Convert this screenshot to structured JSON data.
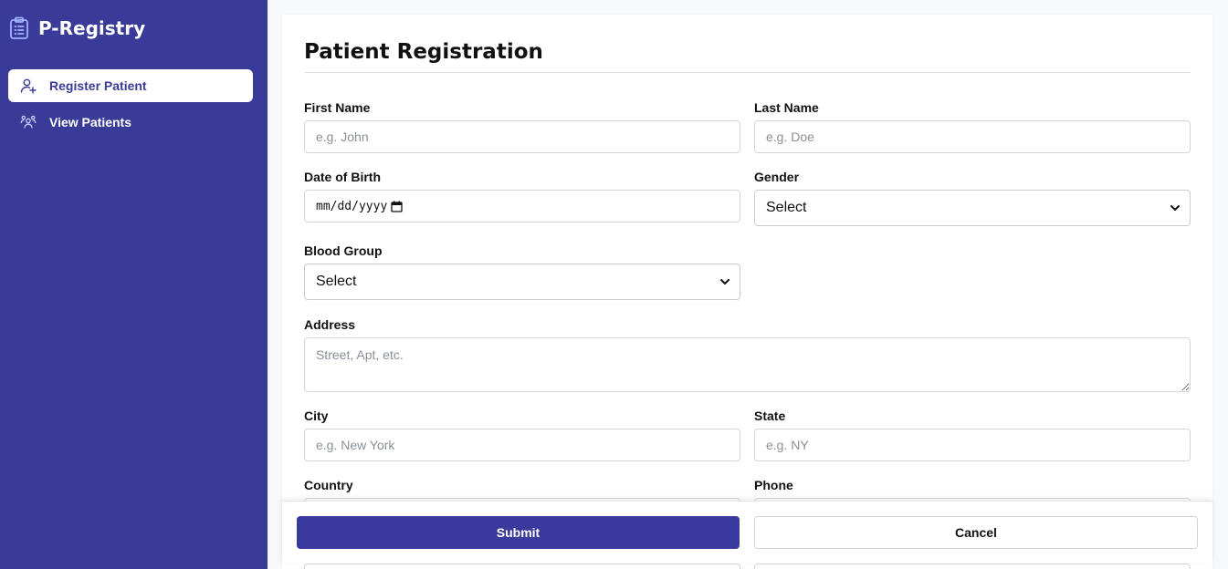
{
  "app": {
    "title": "P-Registry"
  },
  "sidebar": {
    "items": [
      {
        "label": "Register Patient",
        "icon": "user-plus-icon",
        "active": true
      },
      {
        "label": "View Patients",
        "icon": "users-icon",
        "active": false
      }
    ]
  },
  "main": {
    "title": "Patient Registration",
    "fields": {
      "first_name": {
        "label": "First Name",
        "placeholder": "e.g. John",
        "value": ""
      },
      "last_name": {
        "label": "Last Name",
        "placeholder": "e.g. Doe",
        "value": ""
      },
      "dob": {
        "label": "Date of Birth",
        "placeholder": "mm/dd/yyyy"
      },
      "gender": {
        "label": "Gender",
        "selected": "Select"
      },
      "blood_group": {
        "label": "Blood Group",
        "selected": "Select"
      },
      "address": {
        "label": "Address",
        "placeholder": "Street, Apt, etc.",
        "value": ""
      },
      "city": {
        "label": "City",
        "placeholder": "e.g. New York",
        "value": ""
      },
      "state": {
        "label": "State",
        "placeholder": "e.g. NY",
        "value": ""
      },
      "country": {
        "label": "Country"
      },
      "phone": {
        "label": "Phone"
      }
    }
  },
  "footer": {
    "submit_label": "Submit",
    "cancel_label": "Cancel"
  },
  "colors": {
    "sidebar_bg": "#3a3b98",
    "primary": "#393a9b",
    "accent_icon": "#8fa3ff"
  }
}
